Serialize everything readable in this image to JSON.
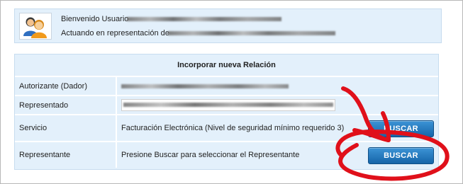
{
  "user": {
    "greeting": "Bienvenido Usuario",
    "acting_as": "Actuando en representación de"
  },
  "relation": {
    "title": "Incorporar nueva Relación",
    "rows": [
      {
        "label": "Autorizante (Dador)",
        "value": ""
      },
      {
        "label": "Representado",
        "value": ""
      },
      {
        "label": "Servicio",
        "value": "Facturación Electrónica (Nivel de seguridad mínimo requerido 3)",
        "button": "BUSCAR"
      },
      {
        "label": "Representante",
        "value": "Presione Buscar para seleccionar el Representante",
        "button": "BUSCAR"
      }
    ]
  },
  "colors": {
    "panel_bg": "#e3f0fb",
    "button": "#1a70b8",
    "annotation": "#e0101a"
  },
  "icons": {
    "avatar": "users-icon"
  }
}
